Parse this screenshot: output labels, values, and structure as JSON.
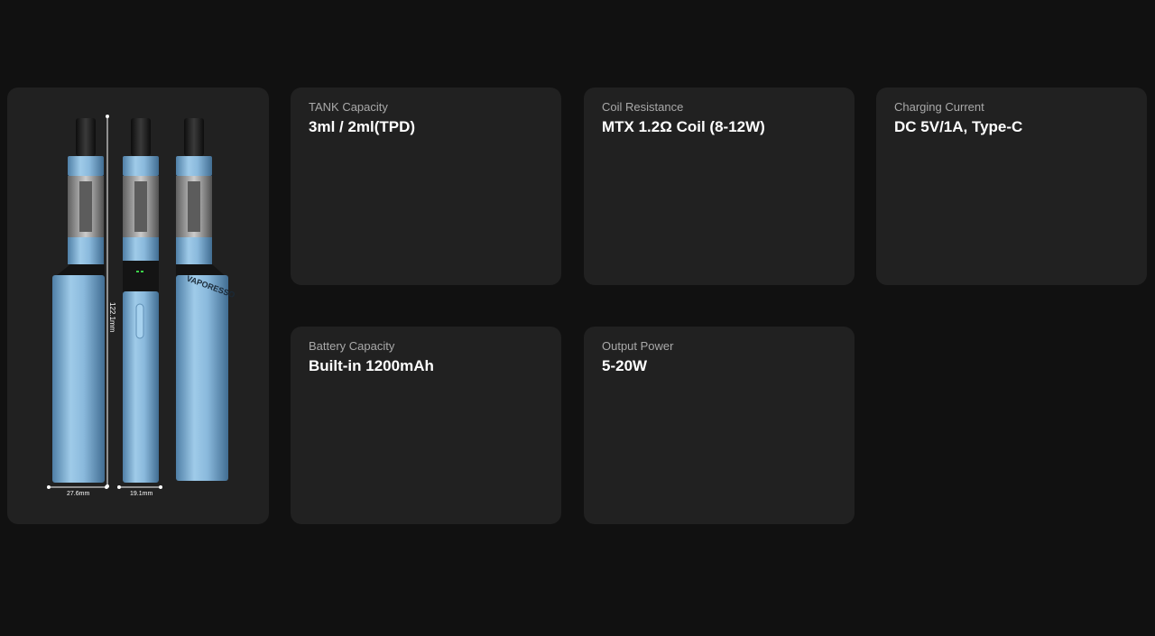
{
  "product": {
    "brand_mark": "VAPORESSO",
    "height_dimension": "122.1mm",
    "width_dimension_1": "27.6mm",
    "width_dimension_2": "19.1mm",
    "body_color": "#8fbfe2",
    "accent_color": "#1a1a1a"
  },
  "specs": [
    {
      "label": "TANK Capacity",
      "value": "3ml / 2ml(TPD)"
    },
    {
      "label": "Coil Resistance",
      "value": "MTX 1.2Ω Coil (8-12W)"
    },
    {
      "label": "Charging Current",
      "value": "DC 5V/1A, Type-C"
    },
    {
      "label": "Battery Capacity",
      "value": "Built-in 1200mAh"
    },
    {
      "label": "Output Power",
      "value": "5-20W"
    }
  ]
}
